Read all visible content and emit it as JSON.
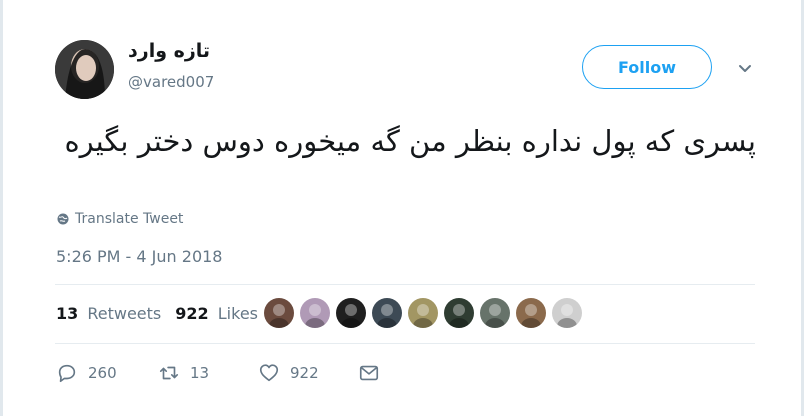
{
  "tweet": {
    "display_name": "تازه وارد",
    "handle": "@vared007",
    "follow_label": "Follow",
    "text": "پسری که پول نداره بنظر من گه میخوره دوس دختر بگیره",
    "translate_label": "Translate Tweet",
    "timestamp": "5:26 PM - 4 Jun 2018",
    "stats": {
      "retweets_count": "13",
      "retweets_label": "Retweets",
      "likes_count": "922",
      "likes_label": "Likes"
    },
    "actions": {
      "reply_count": "260",
      "retweet_count": "13",
      "like_count": "922"
    },
    "liker_avatars": [
      {
        "color": "#6b4b3e"
      },
      {
        "color": "#b09ab6"
      },
      {
        "color": "#1f1f1f"
      },
      {
        "color": "#3d4a55"
      },
      {
        "color": "#a29663"
      },
      {
        "color": "#2f3d32"
      },
      {
        "color": "#67736a"
      },
      {
        "color": "#8b6a4c"
      },
      {
        "color": "#cfcfcf"
      }
    ]
  },
  "colors": {
    "accent": "#1da1f2",
    "muted": "#657786",
    "text": "#14171a"
  }
}
